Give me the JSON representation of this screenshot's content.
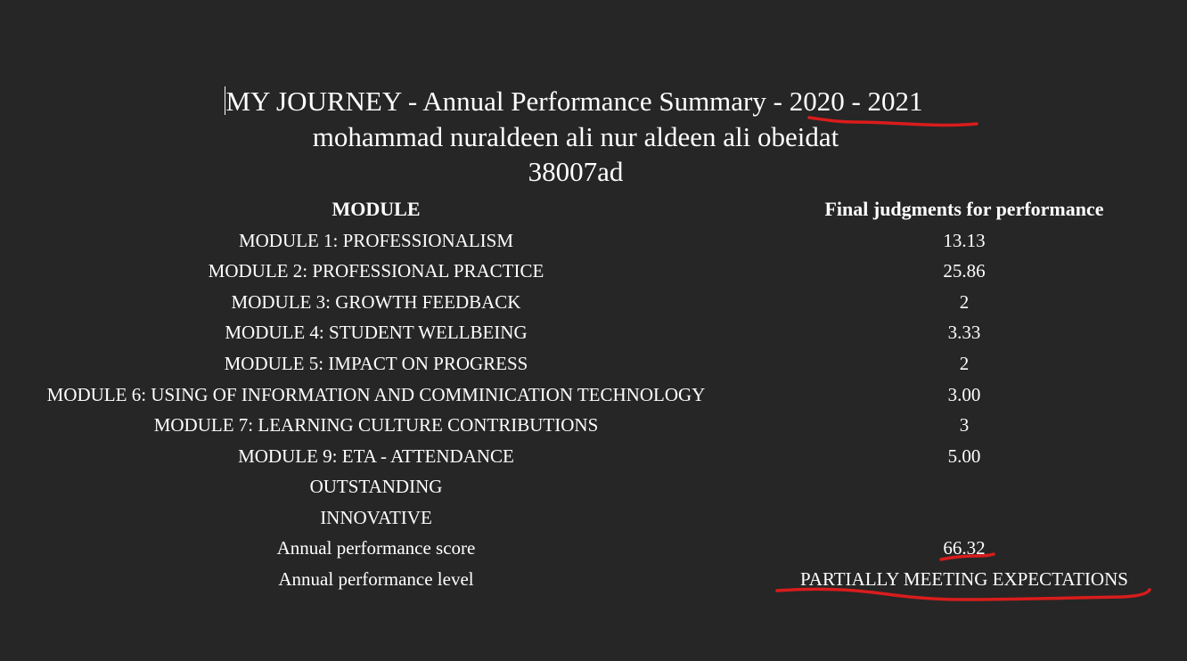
{
  "header": {
    "title_prefix": "MY JOURNEY - Annual Performance Summary - ",
    "title_year": "2020 - 2021",
    "name": "mohammad nuraldeen ali nur aldeen ali obeidat",
    "id": "38007ad"
  },
  "table": {
    "col_module": "MODULE",
    "col_judgment": "Final judgments for performance",
    "rows": [
      {
        "module": "MODULE 1: PROFESSIONALISM",
        "value": "13.13"
      },
      {
        "module": "MODULE 2: PROFESSIONAL PRACTICE",
        "value": "25.86"
      },
      {
        "module": "MODULE 3: GROWTH FEEDBACK",
        "value": "2"
      },
      {
        "module": "MODULE 4: STUDENT WELLBEING",
        "value": "3.33"
      },
      {
        "module": "MODULE 5: IMPACT ON PROGRESS",
        "value": "2"
      },
      {
        "module": "MODULE 6: USING OF INFORMATION AND COMMINICATION TECHNOLOGY",
        "value": "3.00"
      },
      {
        "module": "MODULE 7: LEARNING CULTURE CONTRIBUTIONS",
        "value": "3"
      },
      {
        "module": "MODULE 9: ETA - ATTENDANCE",
        "value": "5.00"
      },
      {
        "module": "OUTSTANDING",
        "value": ""
      },
      {
        "module": "INNOVATIVE",
        "value": ""
      },
      {
        "module": "Annual performance score",
        "value": "66.32"
      },
      {
        "module": "Annual performance level",
        "value": "PARTIALLY MEETING EXPECTATIONS"
      }
    ]
  },
  "colors": {
    "background": "#262626",
    "text": "#ffffff",
    "annotation": "#d91c1c"
  }
}
